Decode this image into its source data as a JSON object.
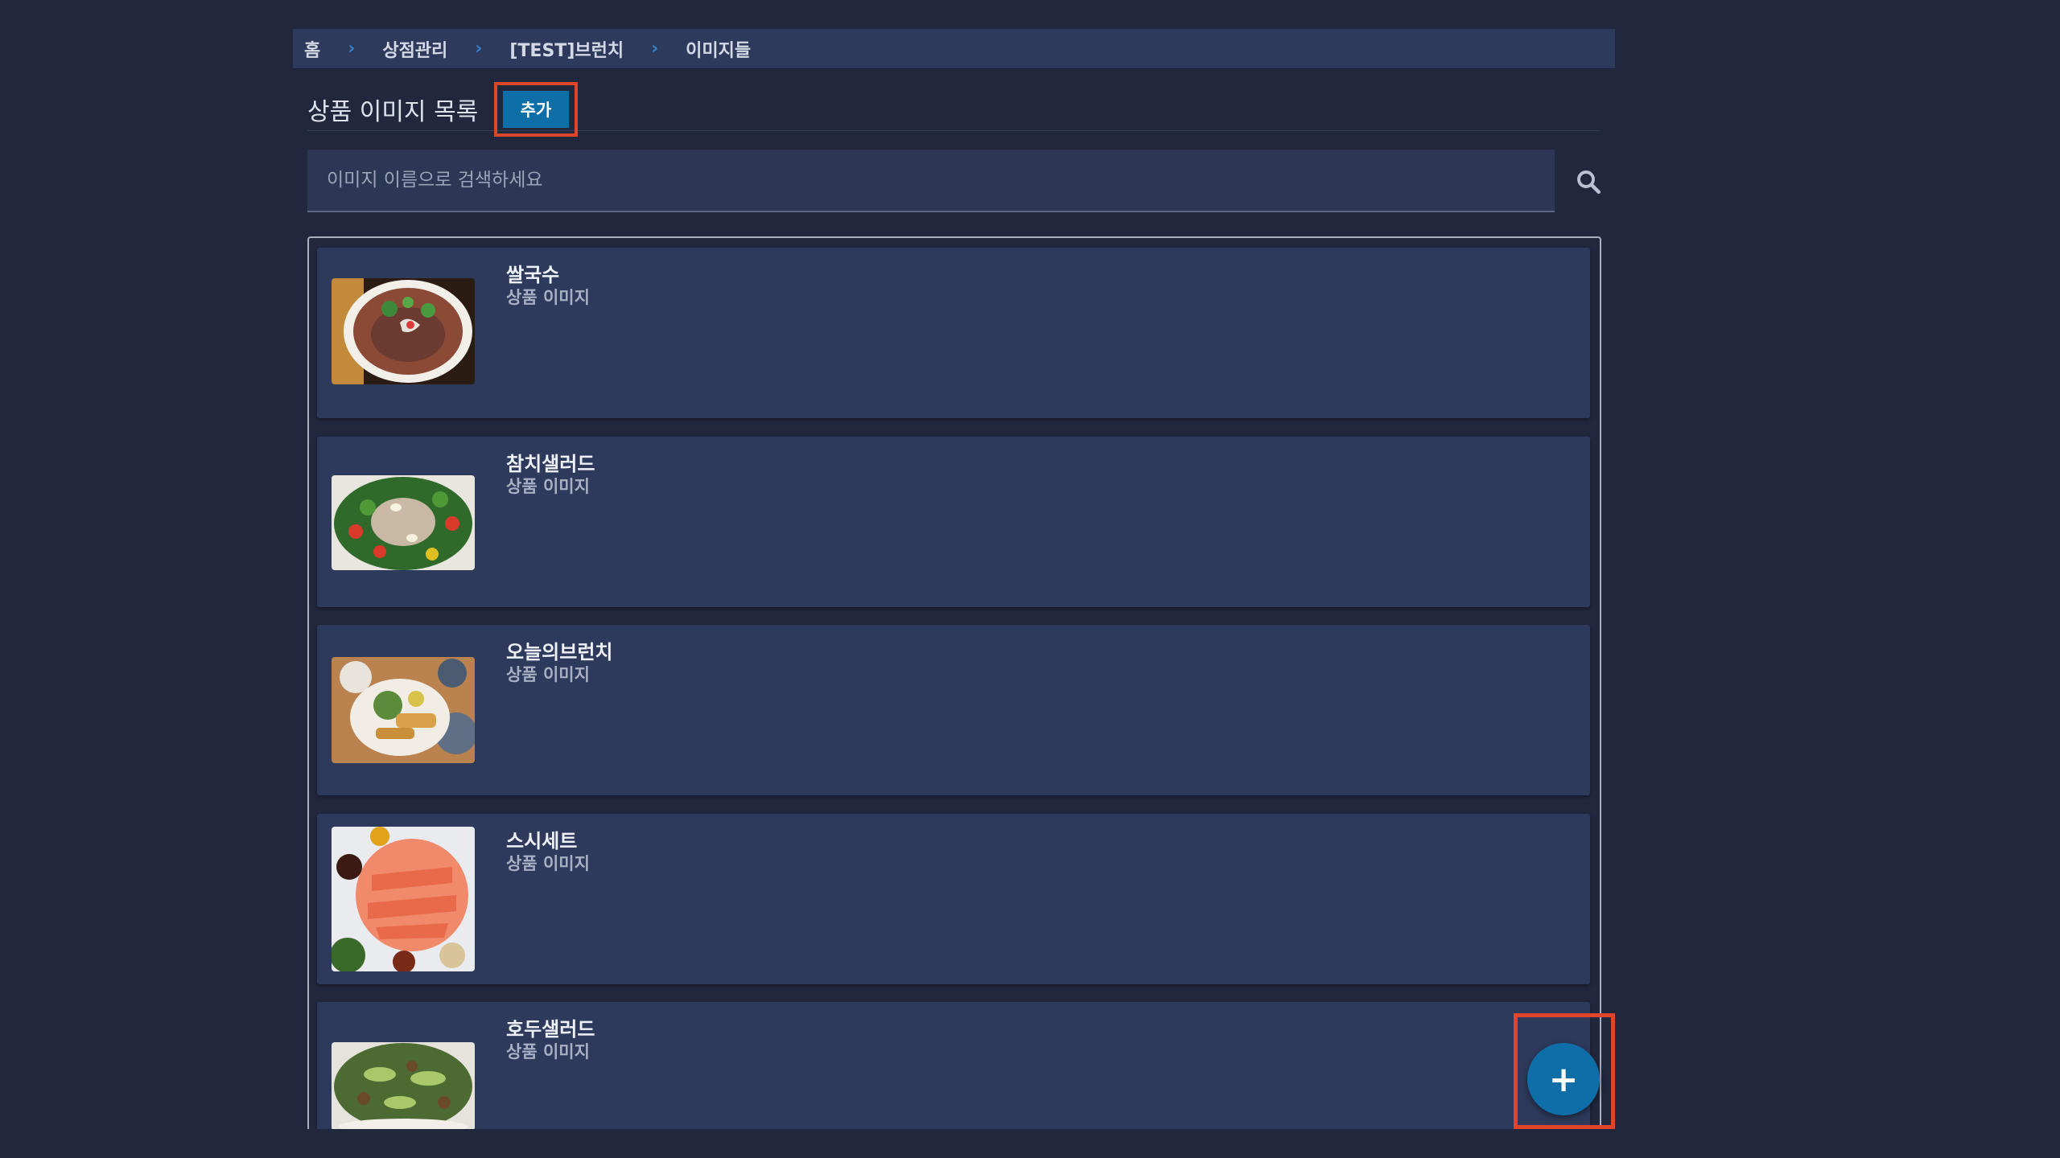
{
  "breadcrumb": {
    "items": [
      "홈",
      "상점관리",
      "[TEST]브런치",
      "이미지들"
    ],
    "separator": "›"
  },
  "header": {
    "title": "상품 이미지 목록",
    "add_label": "추가"
  },
  "search": {
    "placeholder": "이미지 이름으로 검색하세요",
    "value": ""
  },
  "images": [
    {
      "name": "쌀국수",
      "type": "상품 이미지"
    },
    {
      "name": "참치샐러드",
      "type": "상품 이미지"
    },
    {
      "name": "오늘의브런치",
      "type": "상품 이미지"
    },
    {
      "name": "스시세트",
      "type": "상품 이미지"
    },
    {
      "name": "호두샐러드",
      "type": "상품 이미지"
    }
  ],
  "fab": {
    "label": "+"
  },
  "colors": {
    "background": "#21273d",
    "panel": "#2e3a5c",
    "accent": "#0d6ea8",
    "highlight": "#e0452b"
  }
}
